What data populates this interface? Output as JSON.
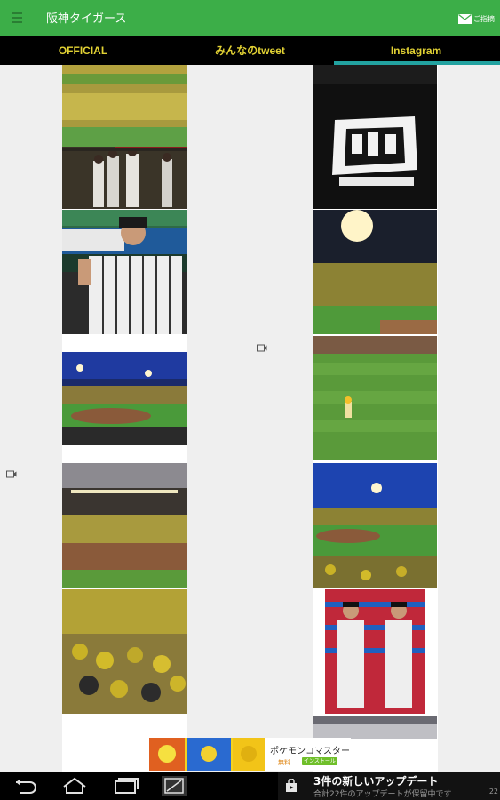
{
  "app": {
    "title": "阪神タイガース",
    "contact_label": "ご指摘",
    "accent_color": "#3cae48"
  },
  "tabs": [
    {
      "label": "OFFICIAL",
      "selected": false
    },
    {
      "label": "みんなのtweet",
      "selected": false
    },
    {
      "label": "Instagram",
      "selected": true
    }
  ],
  "feed": {
    "left_column": [
      {
        "subject": "stadium-crowd"
      },
      {
        "subject": "players-in-dugout"
      },
      {
        "subject": "player-portrait"
      },
      {
        "subject": "night-stadium"
      },
      {
        "subject": "stadium-dusk"
      },
      {
        "subject": "fans-crowd"
      }
    ],
    "right_column": [
      {
        "subject": "dark-strip"
      },
      {
        "subject": "commemorative-logo-shirt"
      },
      {
        "subject": "stadium-lights"
      },
      {
        "subject": "mascot-on-field"
      },
      {
        "subject": "night-field-crowd"
      },
      {
        "subject": "two-players-posing"
      },
      {
        "subject": "stadium-partial"
      }
    ],
    "video_badges": [
      "video-icon",
      "video-icon"
    ]
  },
  "ad": {
    "title": "ポケモンコマスター",
    "price": "無料",
    "install_label": "インストール"
  },
  "notification": {
    "title": "3件の新しいアップデート",
    "subtitle": "合計22件のアップデートが保留中です",
    "clock": "22"
  },
  "system_nav": [
    "back-icon",
    "home-icon",
    "recents-icon",
    "screenshot-icon"
  ]
}
